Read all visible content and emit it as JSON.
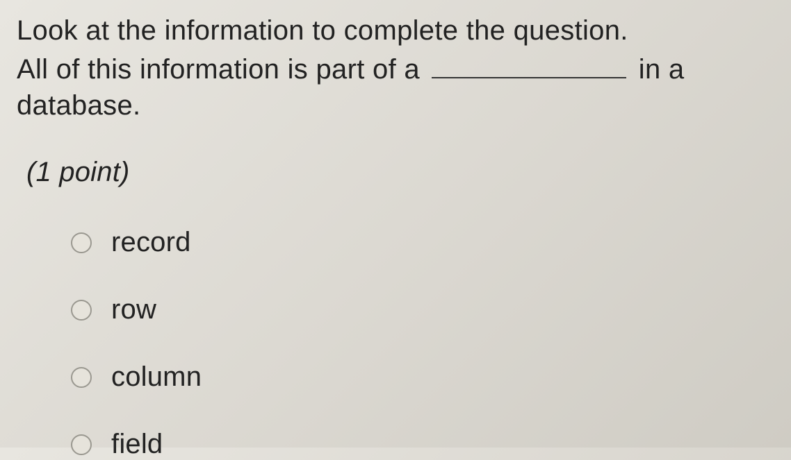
{
  "question": {
    "line1": "Look at the information to complete the question.",
    "line2_pre": "All of this information is part of a ",
    "line2_post": " in a database."
  },
  "points": "(1 point)",
  "options": [
    {
      "label": "record"
    },
    {
      "label": "row"
    },
    {
      "label": "column"
    },
    {
      "label": "field"
    }
  ]
}
